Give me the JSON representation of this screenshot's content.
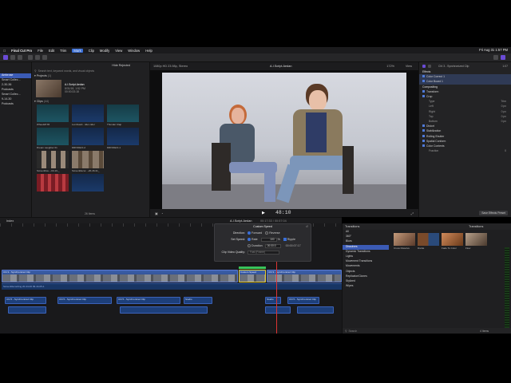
{
  "menubar": {
    "items": [
      "Final Cut Pro",
      "File",
      "Edit",
      "Trim",
      "Mark",
      "Clip",
      "Modify",
      "View",
      "Window",
      "Help"
    ],
    "selected_index": 4,
    "clock": "Fri Aug 31  1:57 PM"
  },
  "library": {
    "items": [
      "Ambrose",
      "Smart Collec...",
      "2-30-36",
      "Podcasts",
      "Smart Collec...",
      "9-14-30",
      "Podcasts"
    ],
    "selected_index": 0
  },
  "browser": {
    "filter": "Hide Rejected",
    "search_placeholder": "Search text, keyword words, and visual objects",
    "projects_header": "Projects",
    "projects_count": "(1)",
    "project_name": "A.I.Script.Aedan",
    "project_date": "8/31/18, 1:52 PM",
    "project_duration": "00:00:33:18",
    "clips_header": "Clips",
    "clips_count": "(44)",
    "clips": [
      {
        "label": "Wheels8 S5"
      },
      {
        "label": "Lumbvard...rider-rider"
      },
      {
        "label": "Thunder Clap"
      },
      {
        "label": "Dream Laughter 01"
      },
      {
        "label": "DRIVDECI-2"
      },
      {
        "label": "DRIVDECI-1"
      },
      {
        "label": "Screenflow...-03-10-_"
      },
      {
        "label": "ScreenRecor...-20-46-31_"
      },
      {
        "label": "26 Items"
      }
    ]
  },
  "viewer": {
    "format": "1080p HD 23.98p, Stereo",
    "title": "A.I.Script.Aedan",
    "zoom": "172%",
    "view_menu": "View",
    "timecode": "48:10"
  },
  "inspector": {
    "clip_title": "ChI 3 - Synchronized Clip",
    "clip_duration": "1:07",
    "sections": [
      {
        "label": "Effects",
        "type": "header"
      },
      {
        "label": "Color Correct 1",
        "type": "item",
        "hl": true
      },
      {
        "label": "Color Board 1",
        "type": "item",
        "hl": true
      },
      {
        "label": "Compositing",
        "type": "header"
      },
      {
        "label": "Transform",
        "type": "item"
      },
      {
        "label": "Crop",
        "type": "item"
      },
      {
        "label": "Type",
        "type": "sub",
        "value": "Trim"
      },
      {
        "label": "Left",
        "type": "sub",
        "value": "0 px"
      },
      {
        "label": "Right",
        "type": "sub",
        "value": "0 px"
      },
      {
        "label": "Top",
        "type": "sub",
        "value": "0 px"
      },
      {
        "label": "Bottom",
        "type": "sub",
        "value": "0 px"
      },
      {
        "label": "Distort",
        "type": "item"
      },
      {
        "label": "Stabilization",
        "type": "item"
      },
      {
        "label": "Rolling Shutter",
        "type": "item"
      },
      {
        "label": "Spatial Conform",
        "type": "item"
      },
      {
        "label": "Color Contents",
        "type": "item"
      },
      {
        "label": "Fraction",
        "type": "sub",
        "value": "0"
      }
    ],
    "save_effects": "Save Effects Preset"
  },
  "timeline": {
    "index_label": "Index",
    "project_title": "A.I.Script.Aedan",
    "project_time": "00:17:33 / 00:57:04",
    "main_clip_label": "ChI 3 - Synchronized Clip",
    "selected_clip_label": "Custom Speed",
    "audio_clip_label": "ScreenRecording 20-44-00 09-44-05-1",
    "audio2_label": "ChI 5 - Synchronized Clip",
    "audio3_label": "Studio"
  },
  "retime": {
    "title": "Custom Speed",
    "direction_label": "Direction:",
    "forward": "Forward",
    "reverse": "Reverse",
    "set_speed_label": "Set Speed:",
    "rate": "Rate",
    "rate_value": "100",
    "rate_unit": "%",
    "ripple": "Ripple",
    "duration": "Duration",
    "duration_value": "00:00:0",
    "duration_value2": "00:00:07:17",
    "quality_label": "Clip Video Quality:",
    "quality_value": "Fast (Frame)"
  },
  "transitions": {
    "header": "Transitions",
    "installed": "Transitions",
    "categories": [
      "All",
      "360°",
      "Blurs",
      "Dissolves",
      "Dynamic Transitions",
      "Lights",
      "Movement Transitions",
      "Movements",
      "Objects",
      "Replicator/Clones",
      "Stylized",
      "Wipes"
    ],
    "selected_index": 3,
    "thumbs": [
      "Cross Dissolve",
      "Divide",
      "Fade To Color",
      "Flow"
    ],
    "count": "4 Items",
    "search_placeholder": "Search"
  }
}
